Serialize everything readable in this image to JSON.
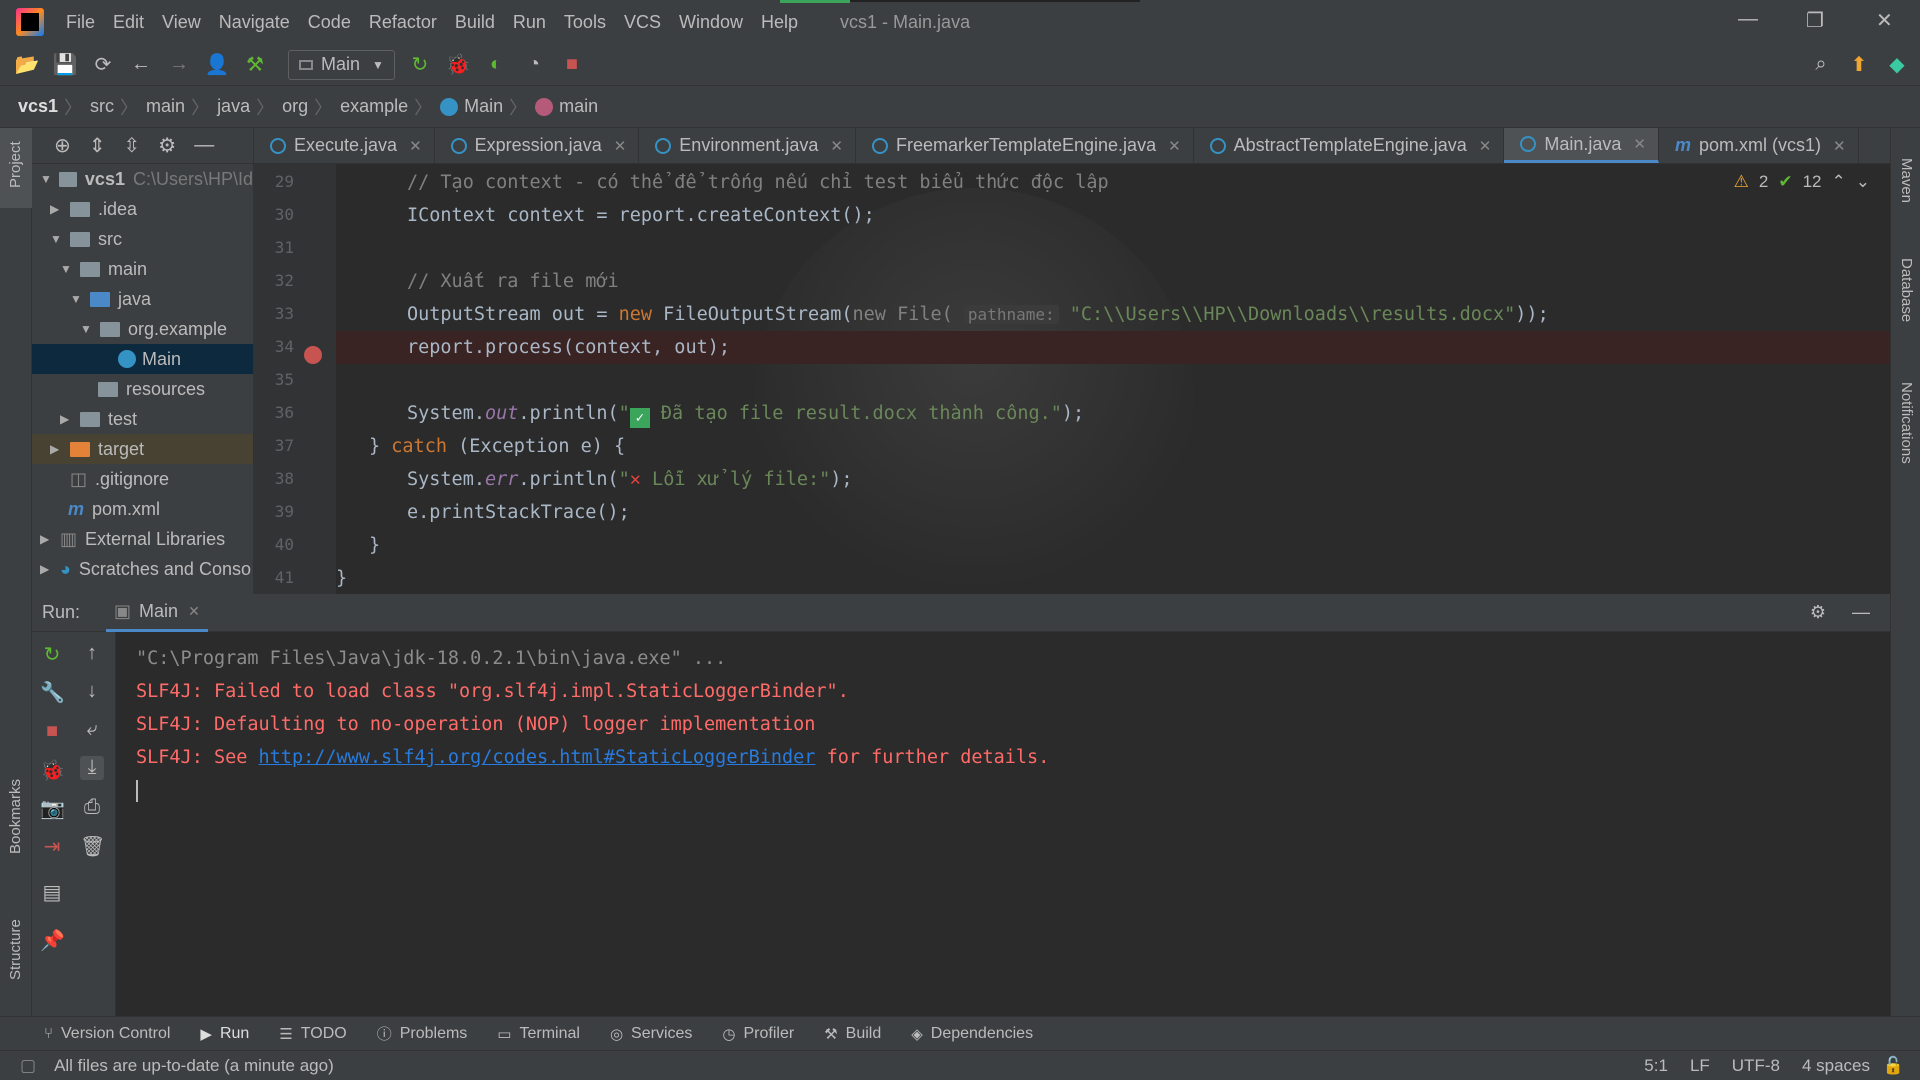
{
  "menubar": {
    "items": [
      "File",
      "Edit",
      "View",
      "Navigate",
      "Code",
      "Refactor",
      "Build",
      "Run",
      "Tools",
      "VCS",
      "Window",
      "Help"
    ],
    "title": "vcs1 - Main.java"
  },
  "toolbar": {
    "run_config": "Main"
  },
  "breadcrumb": {
    "items": [
      "vcs1",
      "src",
      "main",
      "java",
      "org",
      "example",
      "Main",
      "main"
    ]
  },
  "project": {
    "tree": [
      {
        "label": "vcs1",
        "extra": "C:\\Users\\HP\\Id"
      },
      {
        "label": ".idea"
      },
      {
        "label": "src"
      },
      {
        "label": "main"
      },
      {
        "label": "java"
      },
      {
        "label": "org.example"
      },
      {
        "label": "Main"
      },
      {
        "label": "resources"
      },
      {
        "label": "test"
      },
      {
        "label": "target"
      },
      {
        "label": ".gitignore"
      },
      {
        "label": "pom.xml"
      },
      {
        "label": "External Libraries"
      },
      {
        "label": "Scratches and Conso"
      }
    ]
  },
  "tabs": [
    "Execute.java",
    "Expression.java",
    "Environment.java",
    "FreemarkerTemplateEngine.java",
    "AbstractTemplateEngine.java",
    "Main.java",
    "pom.xml (vcs1)"
  ],
  "inspection": {
    "warnings": "2",
    "ok": "12"
  },
  "editor": {
    "line_numbers": [
      "29",
      "30",
      "31",
      "32",
      "33",
      "34",
      "35",
      "36",
      "37",
      "38",
      "39",
      "40",
      "41"
    ],
    "lines": {
      "l29": "// Tạo context - có thể để trống nếu chỉ test biểu thức độc lập",
      "l30": "IContext context = report.createContext();",
      "l32": "// Xuất ra file mới",
      "l33_a": "OutputStream out = ",
      "l33_kw": "new",
      "l33_b": " FileOutputStream(",
      "l33_c": "new File(",
      "l33_hint": "pathname:",
      "l33_str": "\"C:\\\\Users\\\\HP\\\\Downloads\\\\results.docx\"",
      "l33_d": "));",
      "l34": "report.process(context, out);",
      "l36_a": "System.",
      "l36_st": "out",
      "l36_b": ".println(",
      "l36_str1": "\"",
      "l36_str2": " Đã tạo file result.docx thành công.\"",
      "l36_c": ");",
      "l37_a": "} ",
      "l37_kw": "catch",
      "l37_b": " (Exception e) {",
      "l38_a": "System.",
      "l38_st": "err",
      "l38_b": ".println(",
      "l38_str1": "\"",
      "l38_str2": " Lỗi xử lý file:\"",
      "l38_c": ");",
      "l39": "e.printStackTrace();",
      "l40": "}",
      "l41": "}"
    }
  },
  "run": {
    "label": "Run:",
    "tab": "Main",
    "console": {
      "line1": "\"C:\\Program Files\\Java\\jdk-18.0.2.1\\bin\\java.exe\" ...",
      "line2": "SLF4J: Failed to load class \"org.slf4j.impl.StaticLoggerBinder\".",
      "line3": "SLF4J: Defaulting to no-operation (NOP) logger implementation",
      "line4_a": "SLF4J: See ",
      "line4_link": "http://www.slf4j.org/codes.html#StaticLoggerBinder",
      "line4_b": " for further details."
    }
  },
  "side": {
    "left_top": "Project",
    "left_mid": "Bookmarks",
    "left_bot": "Structure",
    "right_top": "Maven",
    "right_mid": "Database",
    "right_bot": "Notifications"
  },
  "toolwindows": [
    "Version Control",
    "Run",
    "TODO",
    "Problems",
    "Terminal",
    "Services",
    "Profiler",
    "Build",
    "Dependencies"
  ],
  "status": {
    "message": "All files are up-to-date (a minute ago)",
    "position": "5:1",
    "line_sep": "LF",
    "encoding": "UTF-8",
    "indent": "4 spaces"
  }
}
